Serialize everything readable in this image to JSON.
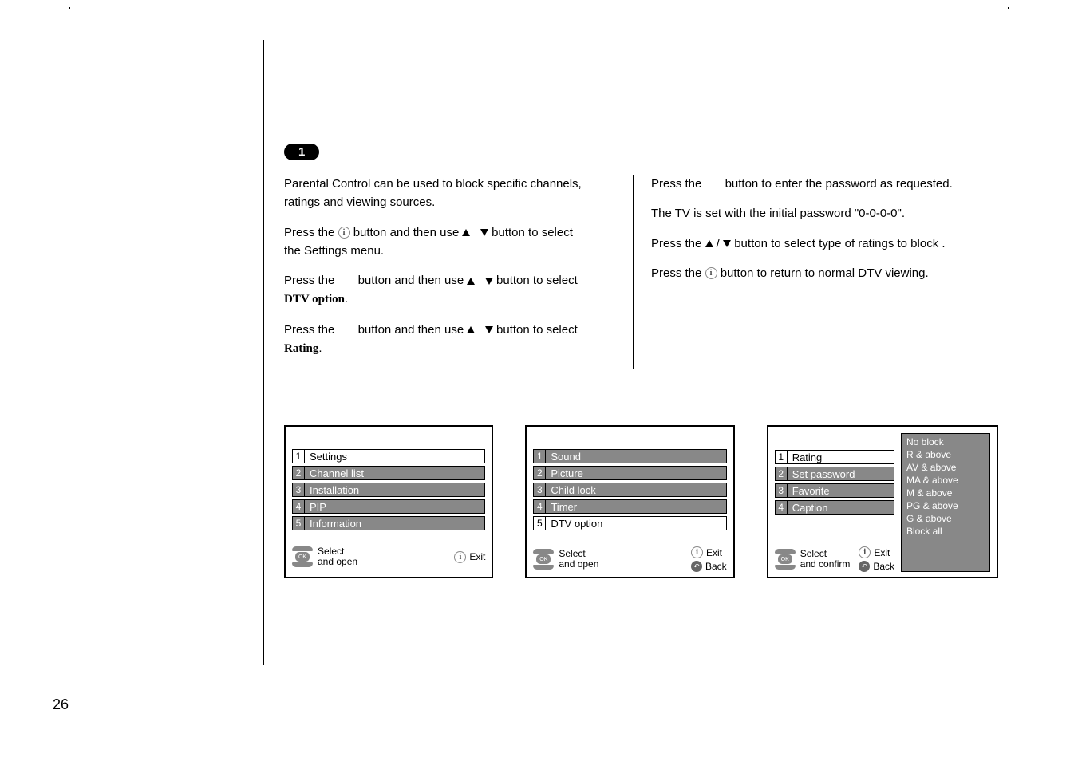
{
  "page_number": "26",
  "step": {
    "number": "1",
    "title": ""
  },
  "left_col": {
    "p1a": "Parental Control can be used to block specific channels,",
    "p1b": "ratings and viewing sources.",
    "p2a": "Press the ",
    "p2b": " button and then use ",
    "p2c": " button to select",
    "p2d": "the Settings menu.",
    "p3a": "Press the",
    "p3b": "button and then use ",
    "p3c": " button to select",
    "p3d": "DTV option",
    "dot": ".",
    "p4a": "Press the",
    "p4b": "button and then use ",
    "p4c": " button to select",
    "p4d": "Rating"
  },
  "right_col": {
    "p1a": "Press the",
    "p1b": "button to enter the password as requested.",
    "p2": "The TV is set with the initial password \"0-0-0-0\".",
    "p3a": "Press the ",
    "p3b": " button to select type of ratings to block .",
    "p4a": "Press the ",
    "p4b": " button to return to normal DTV viewing."
  },
  "menu1": {
    "items": [
      "Settings",
      "Channel list",
      "Installation",
      "PIP",
      "Information"
    ],
    "active": 1,
    "footer_left1": "Select",
    "footer_left2": "and open",
    "footer_right": "Exit"
  },
  "menu2": {
    "items": [
      "Sound",
      "Picture",
      "Child lock",
      "Timer",
      "DTV option"
    ],
    "active": 5,
    "footer_left1": "Select",
    "footer_left2": "and open",
    "footer_right1": "Exit",
    "footer_right2": "Back"
  },
  "menu3": {
    "items": [
      "Rating",
      "Set password",
      "Favorite",
      "Caption"
    ],
    "active": 1,
    "side": [
      "No      block",
      "R  &  above",
      "AV & above",
      "MA & above",
      "M   & above",
      "PG & above",
      "G   & above",
      "Block      all"
    ],
    "footer_left1": "Select",
    "footer_left2": "and confirm",
    "footer_right1": "Exit",
    "footer_right2": "Back"
  }
}
